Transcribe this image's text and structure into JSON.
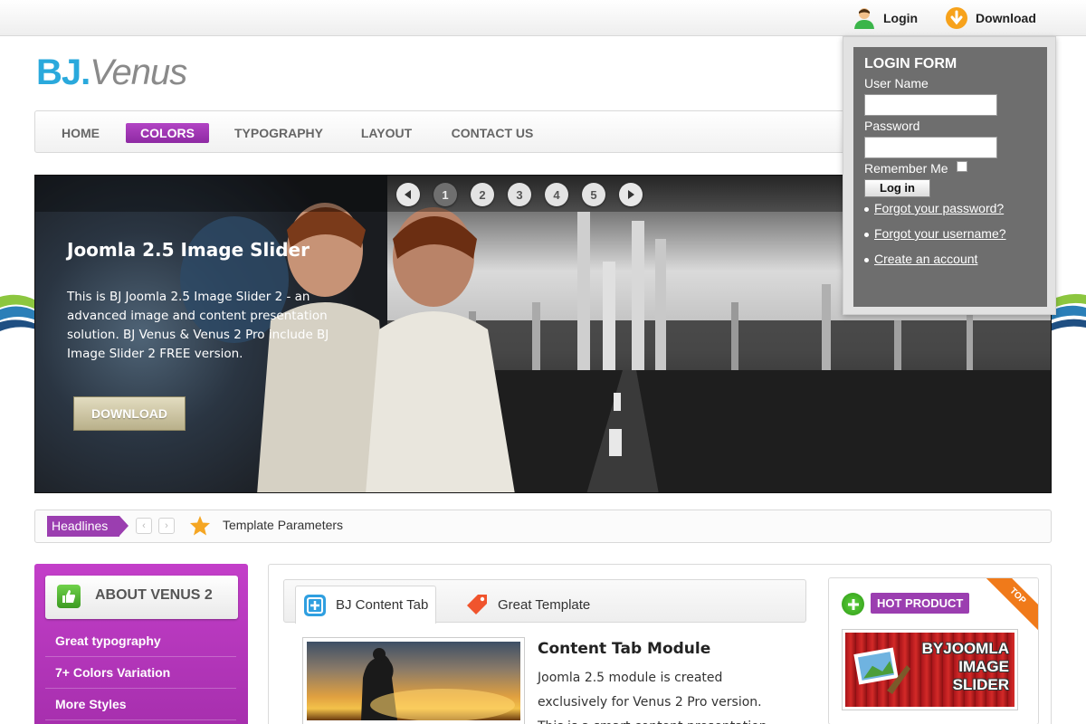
{
  "topbar": {
    "login_label": "Login",
    "download_label": "Download"
  },
  "logo": {
    "part1": "BJ",
    "dot": ".",
    "part2": "Venus"
  },
  "nav": {
    "items": [
      {
        "label": "HOME"
      },
      {
        "label": "COLORS",
        "active": true
      },
      {
        "label": "TYPOGRAPHY"
      },
      {
        "label": "LAYOUT"
      },
      {
        "label": "CONTACT US"
      }
    ]
  },
  "slider": {
    "title": "Joomla 2.5 Image Slider",
    "description": "This is BJ Joomla 2.5 Image Slider 2 - an advanced image and content presentation solution. BJ Venus & Venus 2 Pro include BJ Image Slider 2 FREE version.",
    "button_label": "DOWNLOAD",
    "pages": [
      "1",
      "2",
      "3",
      "4",
      "5"
    ],
    "active_page": "1",
    "prev_icon": "play-left-icon",
    "next_icon": "play-right-icon"
  },
  "headlines": {
    "label": "Headlines",
    "prev": "‹",
    "next": "›",
    "text": "Template Parameters"
  },
  "sidebar": {
    "title": "ABOUT VENUS 2",
    "items": [
      {
        "label": "Great typography"
      },
      {
        "label": "7+ Colors Variation"
      },
      {
        "label": "More Styles"
      }
    ]
  },
  "content_tab": {
    "tabs": [
      {
        "label": "BJ Content Tab",
        "active": true
      },
      {
        "label": "Great Template"
      }
    ],
    "title": "Content Tab Module",
    "description": "Joomla 2.5 module is created exclusively for Venus 2 Pro version. This is a smart content presentation"
  },
  "hot_product": {
    "label": "HOT PRODUCT",
    "ribbon": "TOP",
    "image_text": [
      "BYJOOMLA",
      "IMAGE",
      "SLIDER"
    ]
  },
  "login_form": {
    "title": "LOGIN FORM",
    "username_label": "User Name",
    "username_value": "",
    "password_label": "Password",
    "password_value": "",
    "remember_label": "Remember Me",
    "submit_label": "Log in",
    "links": [
      {
        "label": "Forgot your password?"
      },
      {
        "label": "Forgot your username?"
      },
      {
        "label": "Create an account"
      }
    ]
  },
  "colors": {
    "accent_purple": "#9b3eb0",
    "brand_blue": "#2aa9dc",
    "brand_gray": "#8a8a8a",
    "login_panel": "#6e6e6e"
  }
}
